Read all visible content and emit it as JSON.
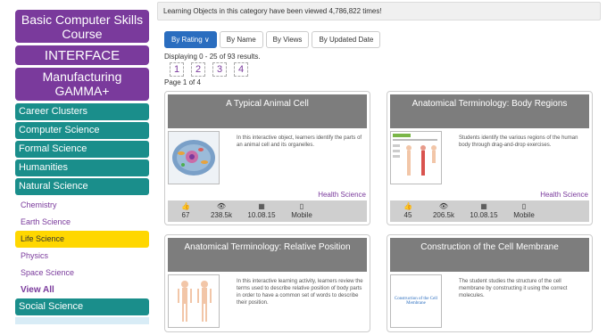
{
  "sidebar": {
    "top_buttons": [
      "Basic Computer Skills Course",
      "INTERFACE",
      "Manufacturing GAMMA+"
    ],
    "clusters": [
      "Career Clusters",
      "Computer Science",
      "Formal Science",
      "Humanities",
      "Natural Science"
    ],
    "natural_science_subs": [
      "Chemistry",
      "Earth Science",
      "Life Science",
      "Physics",
      "Space Science"
    ],
    "view_all": "View All",
    "social_science": "Social Science"
  },
  "notice": "Learning Objects in this category have been viewed 4,786,822 times!",
  "sort": [
    "By Rating ∨",
    "By Name",
    "By Views",
    "By Updated Date"
  ],
  "displaying": "Displaying 0 - 25 of 93 results.",
  "pages": [
    "1",
    "2",
    "3",
    "4"
  ],
  "page_of": "Page 1 of 4",
  "cards": [
    {
      "title": "A Typical Animal Cell",
      "desc": "In this interactive object, learners identify the parts of an animal cell and its organelles.",
      "category": "Health Science",
      "likes": "67",
      "views": "238.5k",
      "date": "10.08.15",
      "device": "Mobile"
    },
    {
      "title": "Anatomical Terminology: Body Regions",
      "desc": "Students identify the various regions of the human body through drag-and-drop exercises.",
      "category": "Health Science",
      "likes": "45",
      "views": "206.5k",
      "date": "10.08.15",
      "device": "Mobile"
    },
    {
      "title": "Anatomical Terminology: Relative Position",
      "desc": "In this interactive learning activity, learners review the terms used to describe relative position of body parts in order to have a common set of words to describe their position."
    },
    {
      "title": "Construction of the Cell Membrane",
      "desc": "The student studies the structure of the cell membrane by constructing it using the correct molecules.",
      "thumb_caption": "Construction of the Cell Membrane"
    }
  ],
  "colors": {
    "purple": "#7a3a9c",
    "teal": "#1a8e8b",
    "active_sub": "#ffd700",
    "sort_active": "#2a6dbf"
  }
}
